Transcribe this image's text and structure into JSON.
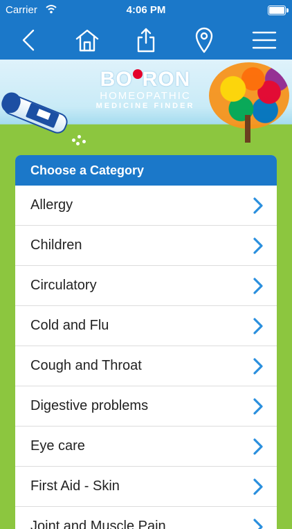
{
  "status_bar": {
    "carrier": "Carrier",
    "time": "4:06 PM"
  },
  "nav": {
    "icons": [
      "back-icon",
      "home-icon",
      "share-icon",
      "location-pin-icon",
      "menu-icon"
    ]
  },
  "banner": {
    "brand_left": "BO",
    "brand_right": "RON",
    "line1": "HOMEOPATHIC",
    "line2": "MEDICINE FINDER"
  },
  "category": {
    "header": "Choose a Category",
    "items": [
      "Allergy",
      "Children",
      "Circulatory",
      "Cold and Flu",
      "Cough and Throat",
      "Digestive problems",
      "Eye care",
      "First Aid - Skin",
      "Joint and Muscle Pain"
    ]
  },
  "colors": {
    "nav_blue": "#1b78c9",
    "page_green": "#8cc63f",
    "chevron_blue": "#2a8fde"
  }
}
